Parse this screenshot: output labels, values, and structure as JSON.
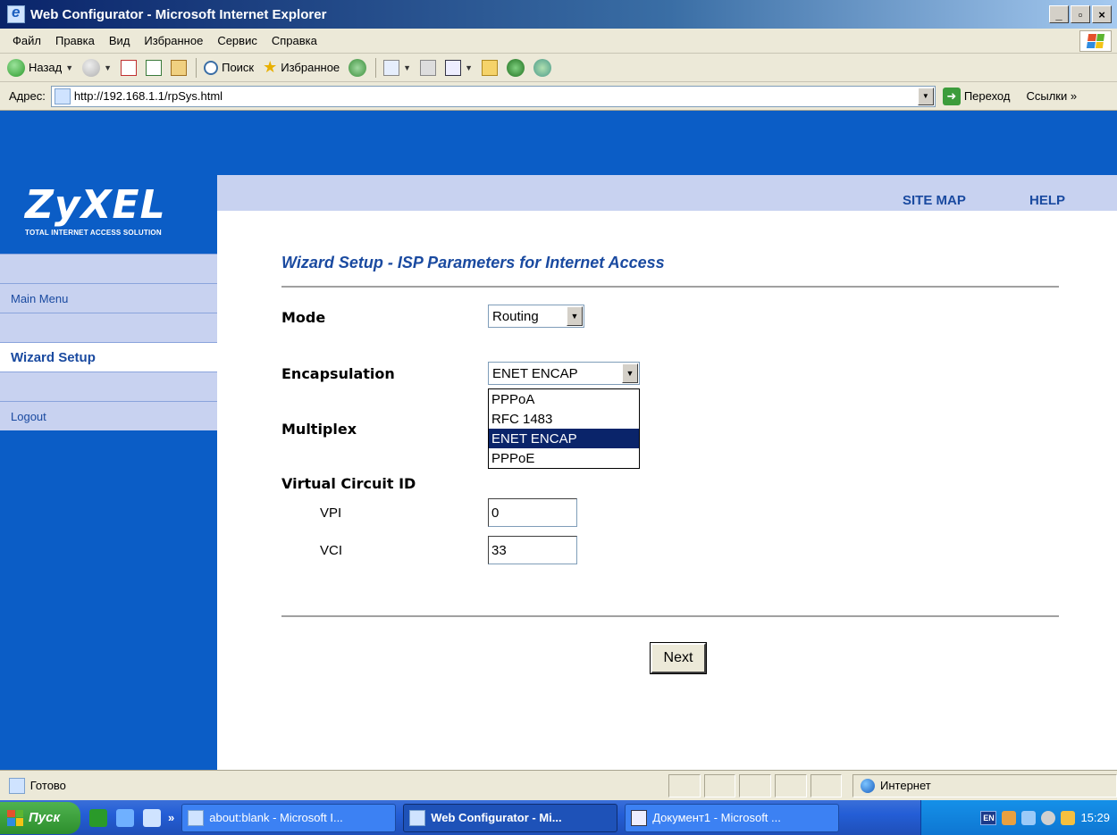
{
  "window": {
    "title": "Web Configurator - Microsoft Internet Explorer",
    "minimize": "_",
    "maximize": "▫",
    "close": "×"
  },
  "menubar": {
    "items": [
      "Файл",
      "Правка",
      "Вид",
      "Избранное",
      "Сервис",
      "Справка"
    ]
  },
  "toolbar": {
    "back_label": "Назад",
    "search_label": "Поиск",
    "favorites_label": "Избранное"
  },
  "addressbar": {
    "label": "Адрес:",
    "url": "http://192.168.1.1/rpSys.html",
    "go_label": "Переход",
    "links_label": "Ссылки »"
  },
  "page": {
    "logo_main": "ZyXEL",
    "logo_sub": "TOTAL INTERNET ACCESS SOLUTION",
    "site_map": "SITE MAP",
    "help": "HELP",
    "nav": {
      "main_menu": "Main Menu",
      "wizard_setup": "Wizard Setup",
      "logout": "Logout"
    },
    "wizard_title": "Wizard Setup - ISP Parameters for Internet Access",
    "mode_label": "Mode",
    "mode_value": "Routing",
    "encapsulation_label": "Encapsulation",
    "encapsulation_value": "ENET ENCAP",
    "encapsulation_options": [
      "PPPoA",
      "RFC 1483",
      "ENET ENCAP",
      "PPPoE"
    ],
    "multiplex_label": "Multiplex",
    "vc_label": "Virtual Circuit ID",
    "vpi_label": "VPI",
    "vpi_value": "0",
    "vci_label": "VCI",
    "vci_value": "33",
    "next_label": "Next"
  },
  "statusbar": {
    "text": "Готово",
    "zone": "Интернет"
  },
  "taskbar": {
    "start_label": "Пуск",
    "chevron": "»",
    "tasks": [
      "about:blank - Microsoft I...",
      "Web Configurator - Mi...",
      "Документ1 - Microsoft ..."
    ],
    "lang": "EN",
    "clock": "15:29"
  },
  "colors": {
    "zyxel_blue": "#0b5dc6",
    "nav_band": "#c8d2f0",
    "link_blue": "#1a4aa0",
    "selected_option": "#0a246a"
  }
}
